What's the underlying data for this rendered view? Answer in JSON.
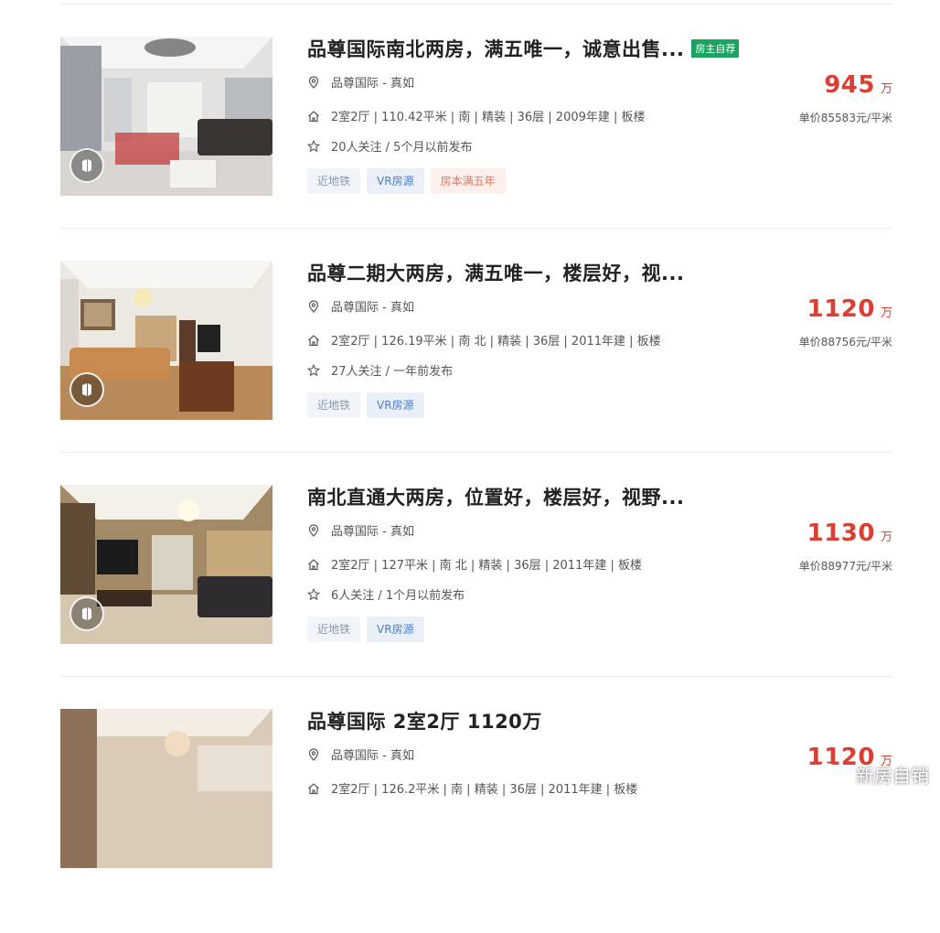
{
  "listings": [
    {
      "title": "品尊国际南北两房，满五唯一，诚意出售...",
      "owner_tag": "房主自荐",
      "location": "品尊国际 - 真如",
      "info": "2室2厅 | 110.42平米 | 南 | 精装 | 36层 | 2009年建 | 板楼",
      "follow": "20人关注 / 5个月以前发布",
      "tags": [
        "近地铁",
        "VR房源",
        "房本满五年"
      ],
      "price": "945",
      "price_unit": "万",
      "unit_price": "单价85583元/平米"
    },
    {
      "title": "品尊二期大两房，满五唯一，楼层好，视...",
      "location": "品尊国际 - 真如",
      "info": "2室2厅 | 126.19平米 | 南 北 | 精装 | 36层 | 2011年建 | 板楼",
      "follow": "27人关注 / 一年前发布",
      "tags": [
        "近地铁",
        "VR房源"
      ],
      "price": "1120",
      "price_unit": "万",
      "unit_price": "单价88756元/平米"
    },
    {
      "title": "南北直通大两房，位置好，楼层好，视野...",
      "location": "品尊国际 - 真如",
      "info": "2室2厅 | 127平米 | 南 北 | 精装 | 36层 | 2011年建 | 板楼",
      "follow": "6人关注 / 1个月以前发布",
      "tags": [
        "近地铁",
        "VR房源"
      ],
      "price": "1130",
      "price_unit": "万",
      "unit_price": "单价88977元/平米"
    },
    {
      "title": "品尊国际 2室2厅 1120万",
      "location": "品尊国际 - 真如",
      "info": "2室2厅 | 126.2平米 | 南 | 精装 | 36层 | 2011年建 | 板楼",
      "price": "1120",
      "price_unit": "万"
    }
  ],
  "watermark": "新房自销",
  "icons": {
    "location": "location-pin-icon",
    "house": "house-icon",
    "follow": "star-icon",
    "vr": "vr-badge-icon",
    "watermark": "wechat-icon"
  },
  "colors": {
    "price": "#d93f32",
    "owner_tag": "#1ba362",
    "vr_tag": "#4b7cc8",
    "five_year_tag": "#e1765d"
  }
}
